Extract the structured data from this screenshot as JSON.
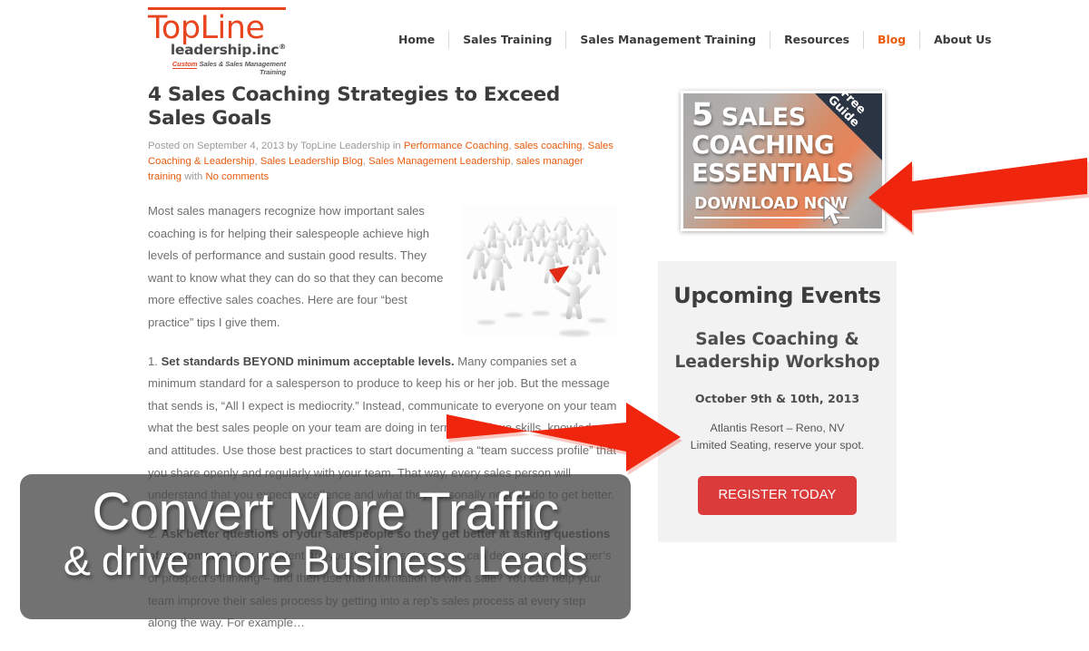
{
  "header": {
    "logo": {
      "word_top": "TopLine",
      "word_sub": "leadership.inc",
      "trademark": "®",
      "tagline_accent": "Custom",
      "tagline_rest": " Sales & Sales Management Training"
    },
    "nav": [
      {
        "label": "Home",
        "active": false
      },
      {
        "label": "Sales Training",
        "active": false
      },
      {
        "label": "Sales Management Training",
        "active": false
      },
      {
        "label": "Resources",
        "active": false
      },
      {
        "label": "Blog",
        "active": true
      },
      {
        "label": "About Us",
        "active": false
      }
    ]
  },
  "article": {
    "title": "4 Sales Coaching Strategies to Exceed Sales Goals",
    "meta": {
      "posted_prefix": "Posted on ",
      "date": "September 4, 2013",
      "by_text": " by ",
      "author": "TopLine Leadership",
      "in_text": " in ",
      "categories": [
        "Performance Coaching",
        "sales coaching",
        "Sales Coaching & Leadership",
        "Sales Leadership Blog",
        "Sales Management Leadership",
        "sales manager training"
      ],
      "with_text": " with ",
      "comments": "No comments"
    },
    "paragraphs": [
      {
        "lead_bold": "",
        "text": "Most sales managers recognize how important sales coaching is for helping their salespeople achieve high levels of performance and sustain good results. They want to know what they can do so that they can become more effective sales coaches. Here are four “best practice” tips I give them."
      },
      {
        "number": "1. ",
        "lead_bold": "Set standards BEYOND minimum acceptable levels.",
        "text": "  Many companies set a minimum standard for a salesperson to produce to keep his or her job. But the message that sends is, “All I expect is mediocrity.” Instead, communicate to everyone on your team what the best sales people on your team are doing in terms of unique skills, knowledge and attitudes. Use those best practices to start documenting a “team success profile” that you share openly and regularly with your team. That way, every sales person will understand that you expect excellence and what they personally need to do to get better."
      },
      {
        "number": "2. ",
        "lead_bold": "Ask better questions of your salespeople so they get better at asking questions of customers.",
        "text": " How confident are you that your salespeople can delve into a customer’s or prospect’s thinking – and then use that information to win a sale? You can help your team improve their sales process by getting into a rep’s sales process at every step along the way. For example…"
      }
    ],
    "thumbnail_alt": "crowd-of-3d-figures-cheering-with-megaphone"
  },
  "sidebar": {
    "promo": {
      "line1_number": "5",
      "line1_word": " SALES",
      "line2": "COACHING",
      "line3": "ESSENTIALS",
      "cta": "DOWNLOAD NOW",
      "ribbon_line1": "Free",
      "ribbon_line2": "Guide",
      "cursor_icon": "mouse-cursor-icon"
    },
    "events": {
      "title": "Upcoming Events",
      "event_name": "Sales Coaching & Leadership Workshop",
      "event_date": "October 9th & 10th, 2013",
      "venue": "Atlantis Resort – Reno, NV",
      "seating_note": "Limited Seating, reserve your spot.",
      "register_label": "REGISTER TODAY"
    }
  },
  "annotations": {
    "overlay": {
      "line1": "Convert More Traffic",
      "line2": "& drive more Business Leads"
    },
    "arrows": [
      {
        "name": "arrow-pointing-to-promo-banner",
        "direction": "left"
      },
      {
        "name": "arrow-pointing-to-upcoming-events",
        "direction": "right"
      }
    ]
  },
  "colors": {
    "brand_orange": "#E8441E",
    "link_orange": "#EA5B0C",
    "annotation_red": "#F0250D",
    "register_red": "#DB3B3B",
    "events_bg": "#F2F2F2",
    "ribbon_navy": "#2B3442",
    "overlay_gray": "#4A4A4A",
    "body_text": "#6F6F6F",
    "heading_text": "#3D3D3D"
  }
}
